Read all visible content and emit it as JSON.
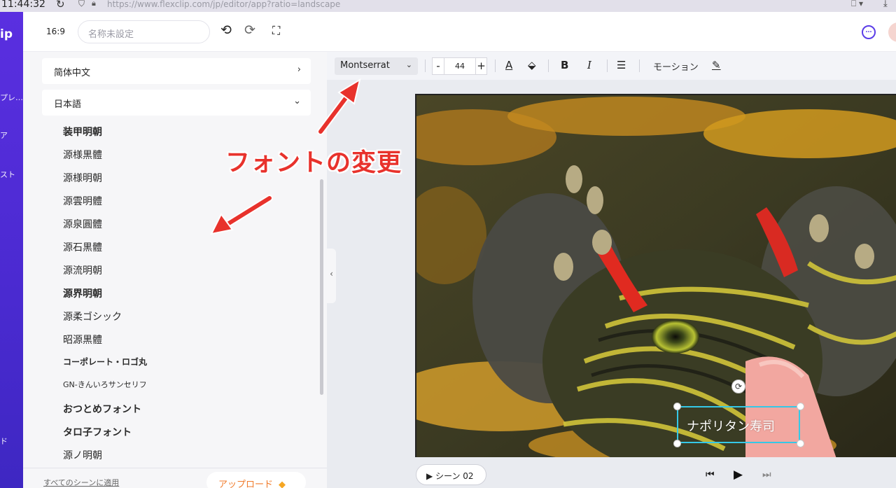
{
  "browser": {
    "time": "11:44:32",
    "url": "https://www.flexclip.com/jp/editor/app?ratio=landscape"
  },
  "left_strip": {
    "logo": "ip",
    "items": [
      "プレ…",
      "ア",
      "スト",
      "ド"
    ]
  },
  "topbar": {
    "ratio": "16:9",
    "name_placeholder": "名称未設定"
  },
  "font_panel": {
    "lang_chinese": "简体中文",
    "lang_japanese": "日本語",
    "fonts": [
      "装甲明朝",
      "源様黒體",
      "源様明朝",
      "源雲明體",
      "源泉圓體",
      "源石黒體",
      "源流明朝",
      "源界明朝",
      "源柔ゴシック",
      "昭源黒體",
      "コーポレート・ロゴ丸",
      "GN-きんいろサンセリフ",
      "おつとめフォント",
      "タロ子フォント",
      "源ノ明朝"
    ],
    "apply_all": "すべてのシーンに適用",
    "upgrade": "アップロード"
  },
  "format_bar": {
    "font": "Montserrat",
    "size": "44",
    "motion": "モーション"
  },
  "canvas": {
    "text": "ナポリタン寿司"
  },
  "bottom": {
    "scene": "シーン 02"
  },
  "annotation": {
    "label": "フォントの変更"
  },
  "colors": {
    "accent": "#5b3de8",
    "annotation": "#e8322c",
    "selection": "#35c8e6",
    "upgrade": "#f07a2a"
  }
}
